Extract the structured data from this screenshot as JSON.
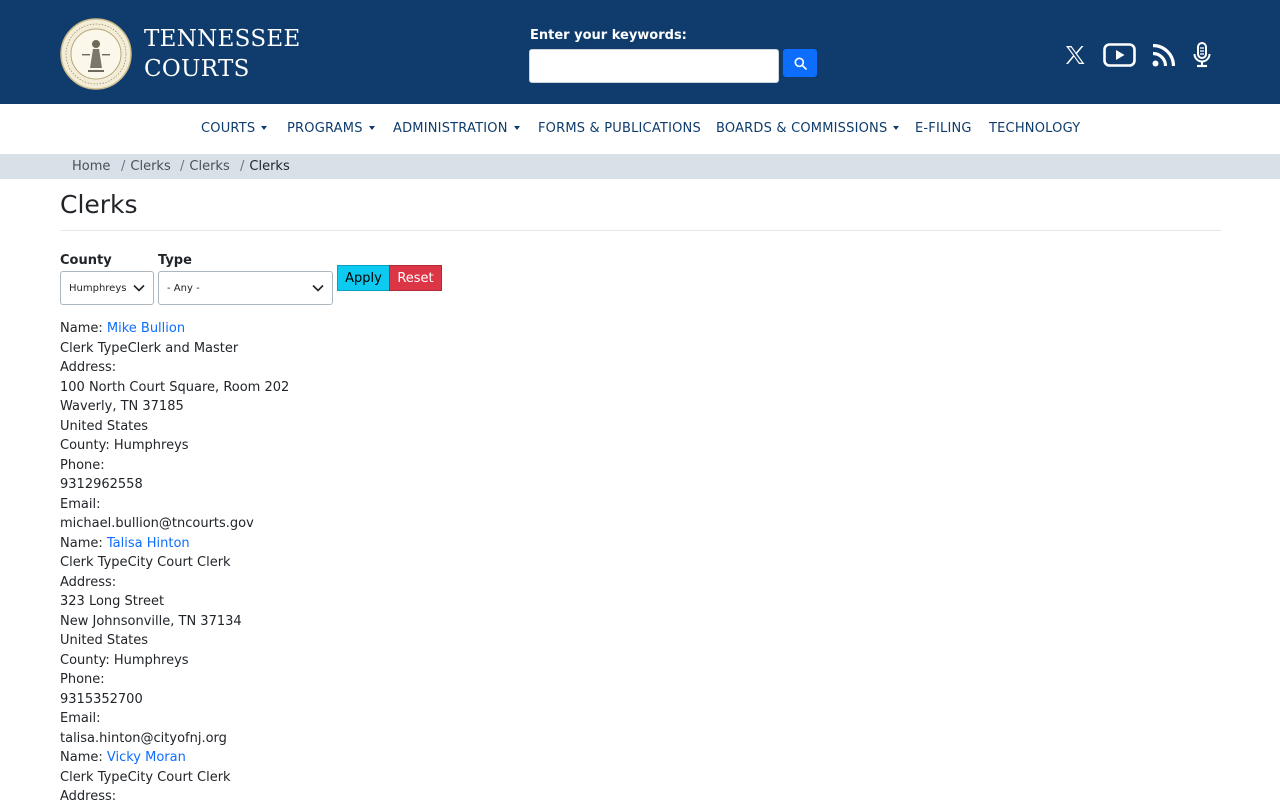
{
  "header": {
    "logo_line1": "TENNESSEE",
    "logo_line2": "COURTS",
    "search_label": "Enter your keywords:",
    "search_value": "",
    "social_icons": [
      "x-icon",
      "youtube-icon",
      "rss-icon",
      "podcast-icon"
    ]
  },
  "nav": {
    "items": [
      {
        "label": "COURTS",
        "dropdown": true
      },
      {
        "label": "PROGRAMS",
        "dropdown": true
      },
      {
        "label": "ADMINISTRATION",
        "dropdown": true
      },
      {
        "label": "FORMS & PUBLICATIONS",
        "dropdown": false
      },
      {
        "label": "BOARDS & COMMISSIONS",
        "dropdown": true
      },
      {
        "label": "E-FILING",
        "dropdown": false
      },
      {
        "label": "TECHNOLOGY",
        "dropdown": false
      }
    ]
  },
  "breadcrumb": [
    "Home",
    "Clerks",
    "Clerks",
    "Clerks"
  ],
  "page": {
    "title": "Clerks"
  },
  "filters": {
    "county_label": "County",
    "county_value": "Humphreys",
    "type_label": "Type",
    "type_value": "- Any -",
    "apply_label": "Apply",
    "reset_label": "Reset"
  },
  "results": {
    "name_prefix": "Name: ",
    "clerk_type_prefix": "Clerk Type",
    "address_label": "Address:",
    "county_prefix": "County: ",
    "phone_label": "Phone:",
    "email_label": "Email:",
    "items": [
      {
        "name": "Mike Bullion",
        "clerk_type": "Clerk and Master",
        "street": "100 North Court Square, Room 202",
        "city_line": "Waverly, TN 37185",
        "country": "United States",
        "county": "Humphreys",
        "phone": "9312962558",
        "email": "michael.bullion@tncourts.gov"
      },
      {
        "name": "Talisa Hinton",
        "clerk_type": "City Court Clerk",
        "street": "323 Long Street",
        "city_line": "New Johnsonville, TN 37134",
        "country": "United States",
        "county": "Humphreys",
        "phone": "9315352700",
        "email": "talisa.hinton@cityofnj.org"
      },
      {
        "name": "Vicky Moran",
        "clerk_type": "City Court Clerk"
      }
    ]
  },
  "colors": {
    "header_bg": "#0f3c6c",
    "link": "#0d6efd",
    "apply": "#0dcaf0",
    "reset": "#dc3545",
    "breadcrumb_bg": "#d8e0e8"
  }
}
